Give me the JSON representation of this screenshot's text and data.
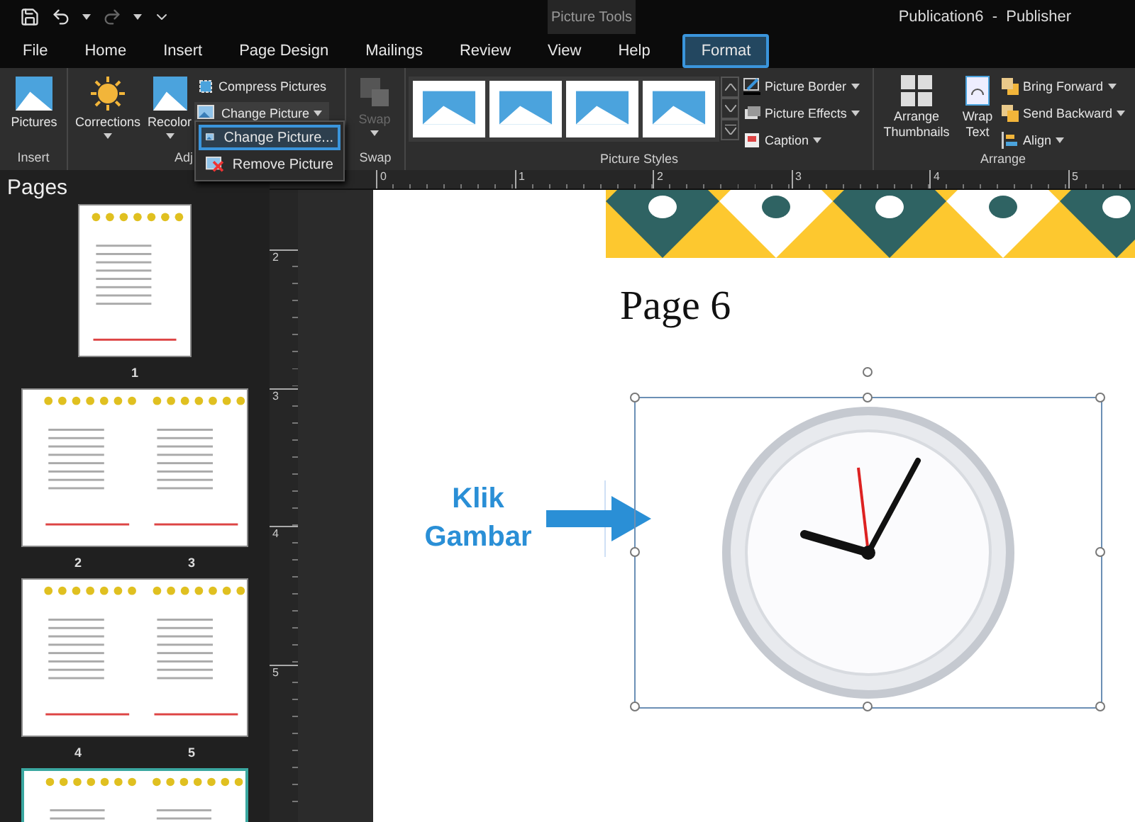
{
  "title_bar": {
    "context_label": "Picture Tools",
    "title": "Publication6  -  Publisher"
  },
  "tabs": [
    {
      "label": "File",
      "selected": false
    },
    {
      "label": "Home",
      "selected": false
    },
    {
      "label": "Insert",
      "selected": false
    },
    {
      "label": "Page Design",
      "selected": false
    },
    {
      "label": "Mailings",
      "selected": false
    },
    {
      "label": "Review",
      "selected": false
    },
    {
      "label": "View",
      "selected": false
    },
    {
      "label": "Help",
      "selected": false
    },
    {
      "label": "Format",
      "selected": true
    }
  ],
  "ribbon": {
    "insert_group": {
      "label": "Insert",
      "pictures": "Pictures"
    },
    "adjust_group": {
      "label": "Adj",
      "corrections": "Corrections",
      "recolor": "Recolor",
      "compress": "Compress Pictures",
      "change": "Change Picture"
    },
    "swap_group": {
      "label": "Swap",
      "swap": {
        "label": "Swap",
        "disabled": true
      }
    },
    "styles_group": {
      "label": "Picture Styles",
      "border": "Picture Border",
      "effects": "Picture Effects",
      "caption": "Caption"
    },
    "arrange_group": {
      "label": "Arrange",
      "arrange_thumbnails": "Arrange Thumbnails",
      "wrap_text": "Wrap Text",
      "bring_forward": "Bring Forward",
      "send_backward": "Send Backward",
      "align": "Align"
    }
  },
  "dropdown_menu": {
    "items": [
      {
        "label": "Change Picture...",
        "selected": true
      },
      {
        "label": "Remove Picture",
        "selected": false
      }
    ]
  },
  "pages_pane": {
    "title": "Pages",
    "thumbnails": [
      {
        "labels": [
          "1"
        ],
        "selected": false
      },
      {
        "labels": [
          "2",
          "3"
        ],
        "selected": false
      },
      {
        "labels": [
          "4",
          "5"
        ],
        "selected": false
      },
      {
        "selected": true
      }
    ]
  },
  "rulers": {
    "horizontal": [
      "0",
      "1",
      "2",
      "3",
      "4",
      "5"
    ],
    "vertical": [
      "2",
      "3",
      "4",
      "5"
    ]
  },
  "document": {
    "page_title": "Page 6",
    "annotation": "Klik Gambar",
    "picture_selected": true
  }
}
